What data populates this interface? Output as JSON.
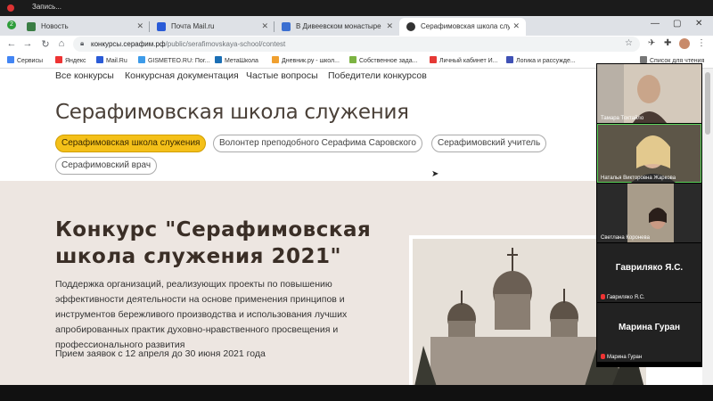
{
  "recording": {
    "label": "Запись..."
  },
  "tabs": [
    {
      "label": "Новость",
      "color": "#3a7d44"
    },
    {
      "label": "Почта Mail.ru",
      "color": "#2a5bd7"
    },
    {
      "label": "В Дивеевском монастыре прод",
      "color": "#3b6fd1"
    },
    {
      "label": "Серафимовская школа служения",
      "color": "#333333"
    }
  ],
  "address": {
    "url_host": "конкурсы.серафим.рф",
    "url_path": "/public/serafimovskaya-school/contest"
  },
  "bookmarks": [
    "Сервисы",
    "Яндекс",
    "Mail.Ru",
    "GISMETEO.RU: Пог...",
    "МетаШкола",
    "Дневник.ру - школ...",
    "Собственное зада...",
    "Личный кабинет И...",
    "Логика и рассужде...",
    "Список для чтения"
  ],
  "topnav": [
    "Все конкурсы",
    "Конкурсная документация",
    "Частые вопросы",
    "Победители конкурсов"
  ],
  "page_title": "Серафимовская школа служения",
  "pills": [
    "Серафимовская школа служения",
    "Волонтер преподобного Серафима Саровского",
    "Серафимовский учитель",
    "Серафимовский врач"
  ],
  "hero": {
    "title_line1": "Конкурс \"Серафимовская",
    "title_line2": "школа служения 2021\"",
    "description": "Поддержка организаций, реализующих проекты по повышению эффективности деятельности на основе применения принципов и инструментов бережливого производства и использования лучших апробированных практик духовно-нравственного просвещения и профессионального развития",
    "dates": "Прием заявок с 12 апреля до 30 июня 2021 года"
  },
  "participants": [
    {
      "name": "Тамара Тохтайло"
    },
    {
      "name": "Наталья Викторовна Жаркова"
    },
    {
      "name": "Светлана Коронева"
    },
    {
      "name": "Гавриляко Я.С.",
      "display": "Гавриляко Я.С."
    },
    {
      "name": "Марина Гуран",
      "display": "Марина Гуран"
    }
  ],
  "colors": {
    "accent_pill": "#f4c019",
    "hero_bg": "#ede6e1"
  }
}
